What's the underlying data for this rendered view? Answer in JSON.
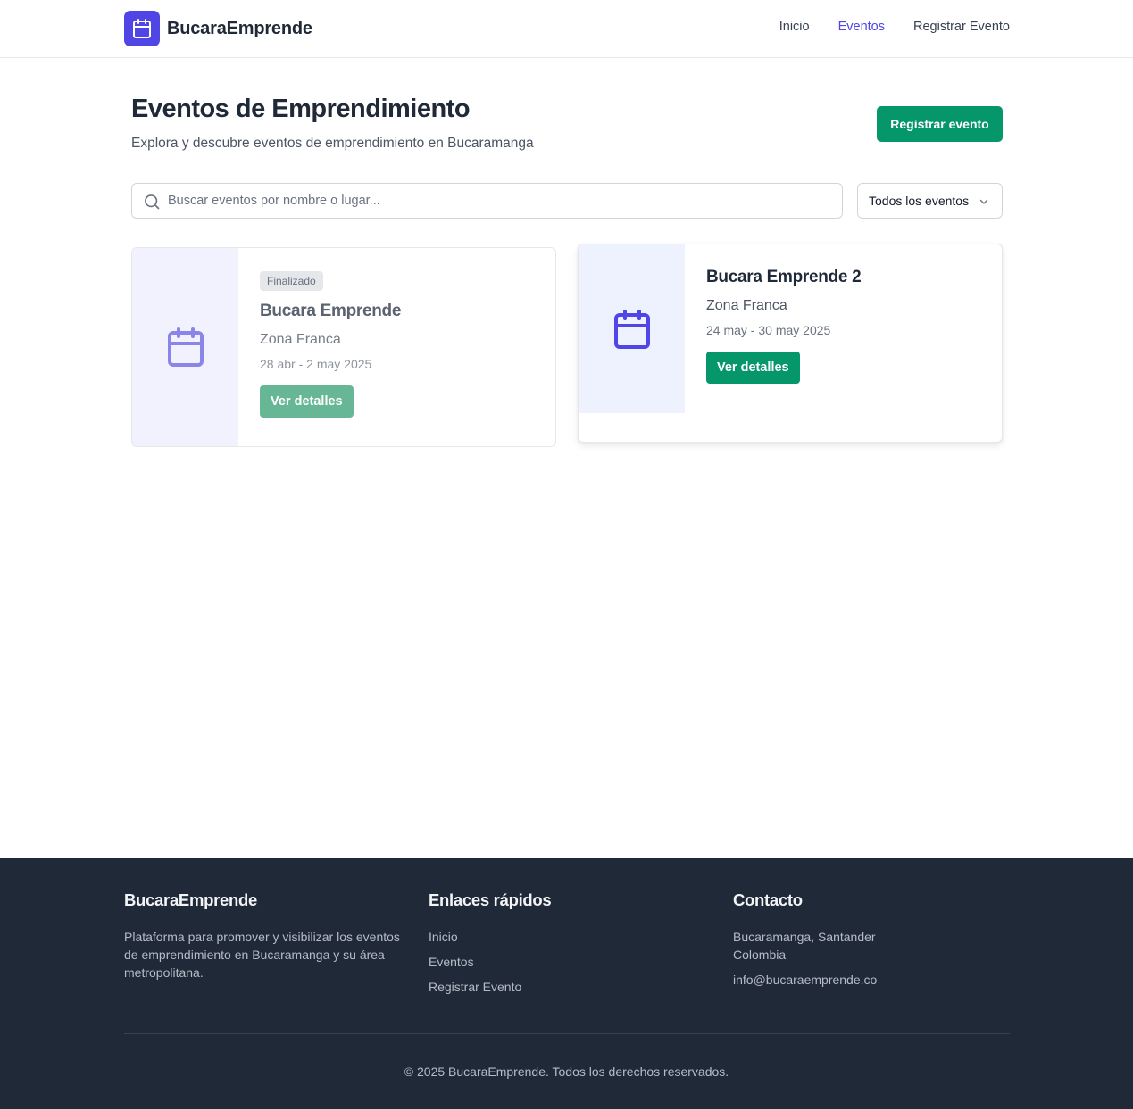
{
  "brand": {
    "name": "BucaraEmprende",
    "icon": "calendar-icon",
    "color": "#4f46e5"
  },
  "nav": {
    "items": [
      {
        "label": "Inicio",
        "active": false
      },
      {
        "label": "Eventos",
        "active": true
      },
      {
        "label": "Registrar Evento",
        "active": false
      }
    ]
  },
  "page": {
    "title": "Eventos de Emprendimiento",
    "subtitle": "Explora y descubre eventos de emprendimiento en Bucaramanga",
    "register_button": "Registrar evento"
  },
  "search": {
    "placeholder": "Buscar eventos por nombre o lugar...",
    "value": ""
  },
  "filter": {
    "selected": "Todos los eventos"
  },
  "events": [
    {
      "badge": "Finalizado",
      "title": "Bucara Emprende",
      "place": "Zona Franca",
      "dates": "28 abr - 2 may 2025",
      "button": "Ver detalles"
    },
    {
      "badge": "",
      "title": "Bucara Emprende 2",
      "place": "Zona Franca",
      "dates": "24 may - 30 may 2025",
      "button": "Ver detalles"
    }
  ],
  "footer": {
    "brand": "BucaraEmprende",
    "description": "Plataforma para promover y visibilizar los eventos de emprendimiento en Bucaramanga y su área metropolitana.",
    "links_title": "Enlaces rápidos",
    "links": [
      "Inicio",
      "Eventos",
      "Registrar Evento"
    ],
    "contact_title": "Contacto",
    "address": "Bucaramanga, Santander Colombia",
    "email": "info@bucaraemprende.co",
    "copyright": "© 2025 BucaraEmprende. Todos los derechos reservados."
  },
  "colors": {
    "primary": "#4f46e5",
    "success": "#059669",
    "footer_bg": "#1f2937"
  }
}
